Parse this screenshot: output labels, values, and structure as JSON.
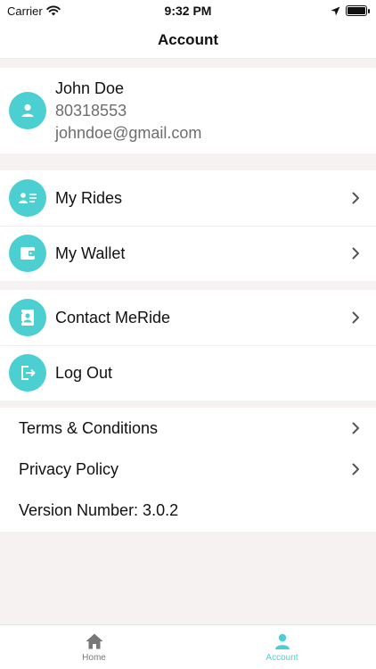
{
  "status": {
    "carrier": "Carrier",
    "time": "9:32 PM"
  },
  "header": {
    "title": "Account"
  },
  "profile": {
    "name": "John Doe",
    "phone": "80318553",
    "email": "johndoe@gmail.com"
  },
  "menu_group_1": [
    {
      "label": "My Rides",
      "icon": "rides-icon"
    },
    {
      "label": "My Wallet",
      "icon": "wallet-icon"
    }
  ],
  "menu_group_2": [
    {
      "label": "Contact MeRide",
      "icon": "contact-icon"
    },
    {
      "label": "Log Out",
      "icon": "logout-icon"
    }
  ],
  "info": {
    "terms": "Terms & Conditions",
    "privacy": "Privacy Policy",
    "version": "Version Number: 3.0.2"
  },
  "tabs": {
    "home": "Home",
    "account": "Account"
  },
  "colors": {
    "accent": "#4ccfd0",
    "background": "#f6f2f1"
  }
}
